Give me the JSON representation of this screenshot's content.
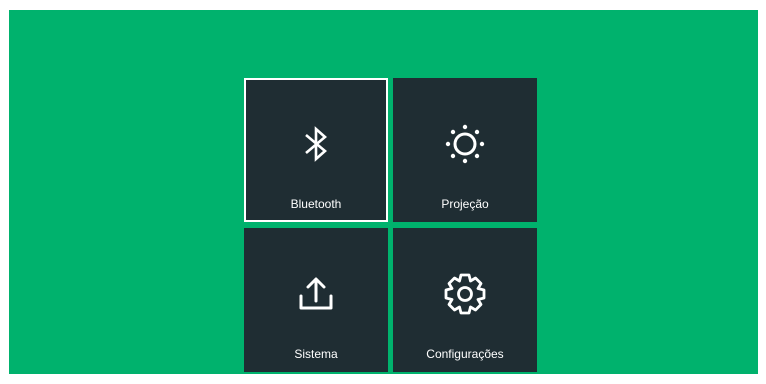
{
  "colors": {
    "background": "#00b26d",
    "tile": "#1f2d33",
    "text": "#ffffff",
    "selection": "#ffffff"
  },
  "menu": {
    "selected": "bluetooth",
    "tiles": [
      {
        "id": "bluetooth",
        "label": "Bluetooth",
        "icon": "bluetooth-icon"
      },
      {
        "id": "projecao",
        "label": "Projeção",
        "icon": "brightness-icon"
      },
      {
        "id": "sistema",
        "label": "Sistema",
        "icon": "upload-icon"
      },
      {
        "id": "configuracoes",
        "label": "Configurações",
        "icon": "gear-icon"
      }
    ]
  }
}
